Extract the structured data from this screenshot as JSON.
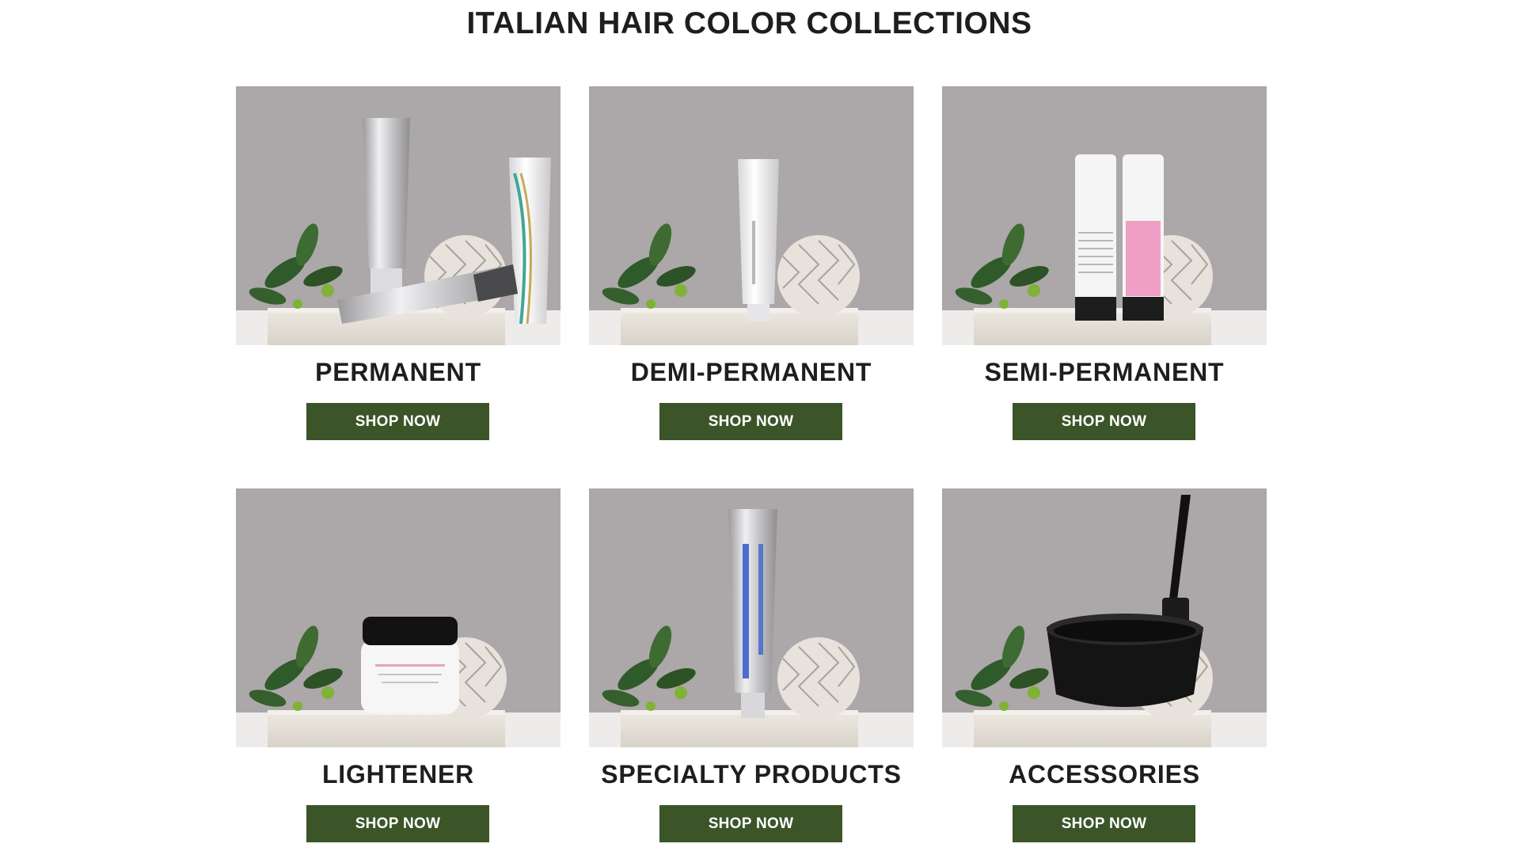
{
  "page_title": "ITALIAN HAIR COLOR COLLECTIONS",
  "colors": {
    "button_bg": "#3b5528",
    "button_text": "#ffffff",
    "heading_text": "#1e1e1e",
    "photo_backdrop": "#aca7a9"
  },
  "collections": [
    {
      "label": "PERMANENT",
      "button": "SHOP NOW",
      "image": "permanent-color-tubes-photo"
    },
    {
      "label": "DEMI-PERMANENT",
      "button": "SHOP NOW",
      "image": "demi-permanent-tube-photo"
    },
    {
      "label": "SEMI-PERMANENT",
      "button": "SHOP NOW",
      "image": "semi-permanent-bottles-photo"
    },
    {
      "label": "LIGHTENER",
      "button": "SHOP NOW",
      "image": "lightener-jar-photo"
    },
    {
      "label": "SPECIALTY PRODUCTS",
      "button": "SHOP NOW",
      "image": "barrier-cream-tube-photo"
    },
    {
      "label": "ACCESSORIES",
      "button": "SHOP NOW",
      "image": "color-bowl-and-brush-photo"
    }
  ]
}
